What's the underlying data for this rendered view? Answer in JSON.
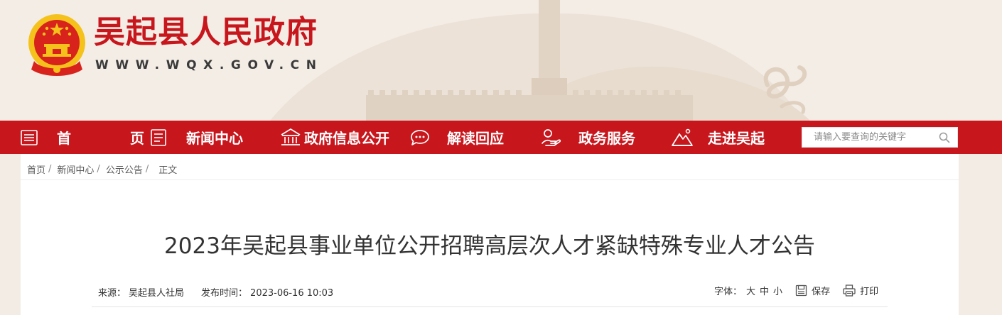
{
  "site": {
    "title": "吴起县人民政府",
    "url": "WWW.WQX.GOV.CN"
  },
  "nav": {
    "items": [
      {
        "label": "首 页",
        "icon": "list-icon"
      },
      {
        "label": "新闻中心",
        "icon": "news-icon"
      },
      {
        "label": "政府信息公开",
        "icon": "building-icon"
      },
      {
        "label": "解读回应",
        "icon": "chat-icon"
      },
      {
        "label": "政务服务",
        "icon": "hand-service-icon"
      },
      {
        "label": "走进吴起",
        "icon": "mountain-icon"
      }
    ],
    "search_placeholder": "请输入要查询的关键字"
  },
  "breadcrumb": {
    "items": [
      "首页",
      "新闻中心",
      "公示公告"
    ],
    "separator": "/",
    "current": "正文"
  },
  "article": {
    "title": "2023年吴起县事业单位公开招聘高层次人才紧缺特殊专业人才公告",
    "source_label": "来源：",
    "source": "吴起县人社局",
    "time_label": "发布时间：",
    "time": "2023-06-16 10:03"
  },
  "tools": {
    "font_label": "字体：",
    "sizes": [
      "大",
      "中",
      "小"
    ],
    "save_label": "保存",
    "print_label": "打印"
  },
  "colors": {
    "brand_red": "#c8161d",
    "header_bg": "#f4ede6",
    "page_bg": "#f3ece4"
  }
}
